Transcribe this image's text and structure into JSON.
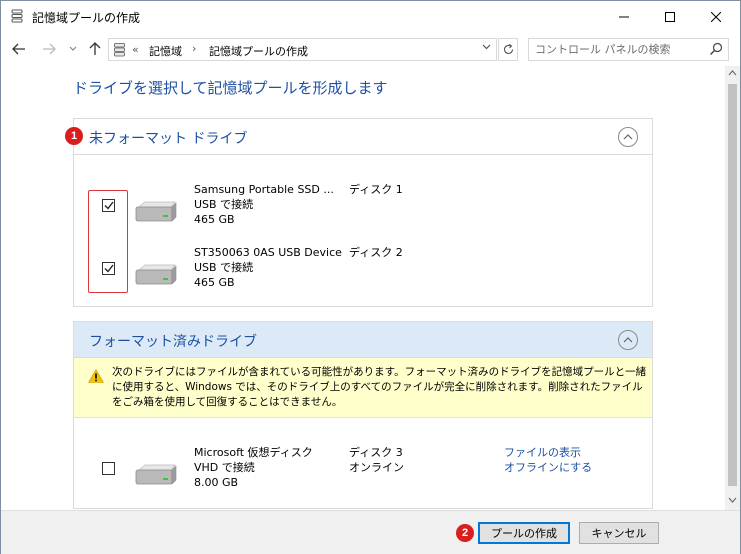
{
  "window": {
    "title": "記憶域プールの作成"
  },
  "nav": {
    "breadcrumb_prefix": "«",
    "crumbs": [
      "記憶域",
      "記憶域プールの作成"
    ],
    "search_placeholder": "コントロール パネルの検索"
  },
  "main": {
    "heading": "ドライブを選択して記憶域プールを形成します",
    "unformatted_section": {
      "title": "未フォーマット ドライブ",
      "drives": [
        {
          "name": "Samsung Portable SSD ...",
          "connection": "USB で接続",
          "size": "465 GB",
          "disk": "ディスク 1",
          "checked": true
        },
        {
          "name": "ST350063 0AS USB Device",
          "connection": "USB で接続",
          "size": "465 GB",
          "disk": "ディスク 2",
          "checked": true
        }
      ]
    },
    "formatted_section": {
      "title": "フォーマット済みドライブ",
      "warning": "次のドライブにはファイルが含まれている可能性があります。フォーマット済みのドライブを記憶域プールと一緒に使用すると、Windows では、そのドライブ上のすべてのファイルが完全に削除されます。削除されたファイルをごみ箱を使用して回復することはできません。",
      "drives": [
        {
          "name": "Microsoft 仮想ディスク",
          "connection": "VHD で接続",
          "size": "8.00 GB",
          "disk": "ディスク 3",
          "status": "オンライン",
          "link_view": "ファイルの表示",
          "link_offline": "オフラインにする",
          "checked": false
        }
      ]
    }
  },
  "annotations": {
    "badge1": "1",
    "badge2": "2"
  },
  "footer": {
    "create_label": "プールの作成",
    "cancel_label": "キャンセル"
  },
  "colors": {
    "link": "#1e50a2",
    "section_header_formatted": "#dceaf7",
    "warning_bg": "#ffffcc",
    "badge": "#d91e1e",
    "highlight_box": "#d93a3a"
  }
}
